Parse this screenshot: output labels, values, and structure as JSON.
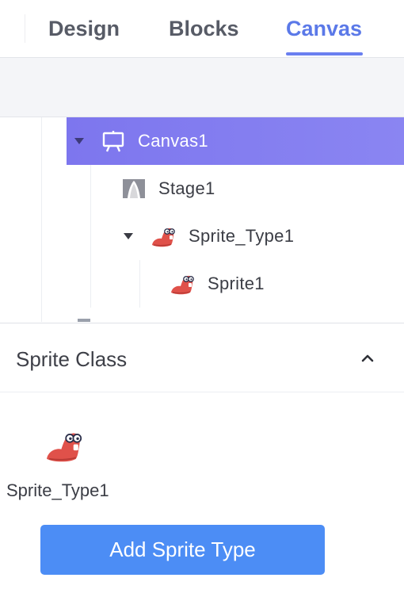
{
  "tabs": {
    "design": "Design",
    "blocks": "Blocks",
    "canvas": "Canvas",
    "active": "Canvas",
    "accent_color": "#5b79e8"
  },
  "tree": {
    "canvas_node": {
      "label": "Canvas1",
      "icon": "canvas-easel-icon",
      "expanded": true,
      "selected": true
    },
    "stage_node": {
      "label": "Stage1",
      "icon": "stage-icon"
    },
    "sprite_type_node": {
      "label": "Sprite_Type1",
      "icon": "sprite-creature-icon",
      "expanded": true
    },
    "sprite_node": {
      "label": "Sprite1",
      "icon": "sprite-creature-icon"
    },
    "selected_color": "#7d76ee"
  },
  "sprite_class": {
    "title": "Sprite Class",
    "toggle_icon": "chevron-up-icon",
    "types": [
      {
        "name": "Sprite_Type1",
        "icon": "sprite-creature-icon"
      }
    ],
    "add_button_label": "Add Sprite Type",
    "button_color": "#4c8df5"
  }
}
